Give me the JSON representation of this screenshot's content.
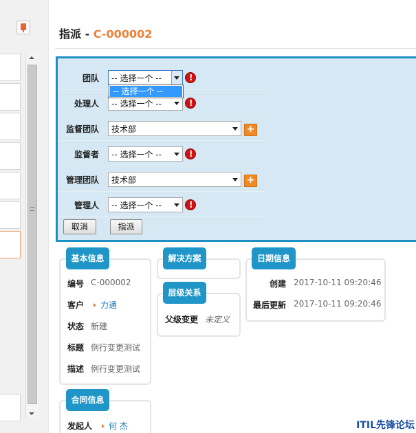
{
  "header": {
    "title_prefix": "指派 - ",
    "record_code": "C-000002"
  },
  "assign_form": {
    "fields": [
      {
        "label": "团队",
        "value": "-- 选择一个 --",
        "required": true
      },
      {
        "label": "处理人",
        "value": "-- 选择一个 --",
        "required": true
      },
      {
        "label": "监督团队",
        "value": "技术部",
        "add": "+"
      },
      {
        "label": "监督者",
        "value": "-- 选择一个 --",
        "required": true
      },
      {
        "label": "管理团队",
        "value": "技术部",
        "add": "+"
      },
      {
        "label": "管理人",
        "value": "-- 选择一个 --",
        "required": true
      }
    ],
    "dropdown_highlight": "-- 选择一个 --",
    "cancel_label": "取消",
    "assign_label": "指派"
  },
  "basic_info": {
    "tab": "基本信息",
    "rows": [
      {
        "key": "编号",
        "value": "C-000002"
      },
      {
        "key": "客户",
        "value": "力通"
      },
      {
        "key": "状态",
        "value": "新建"
      },
      {
        "key": "标题",
        "value": "例行变更测试"
      },
      {
        "key": "描述",
        "value": "例行变更测试"
      }
    ]
  },
  "solution": {
    "tab": "解决方案"
  },
  "hierarchy": {
    "tab": "层级关系",
    "parent_key": "父级变更",
    "parent_value": "未定义"
  },
  "date_info": {
    "tab": "日期信息",
    "created_key": "创建",
    "created_value": "2017-10-11 09:20:46",
    "updated_key": "最后更新",
    "updated_value": "2017-10-11 09:20:46"
  },
  "contract_info": {
    "tab": "合同信息",
    "initiator_key": "发起人",
    "initiator_value": "何 杰"
  },
  "watermark": "ITIL先锋论坛",
  "colors": {
    "accent_blue": "#1f95c8",
    "orange": "#e8823a",
    "required_red": "#cf1212",
    "panel_bg": "#d5e8f3"
  }
}
